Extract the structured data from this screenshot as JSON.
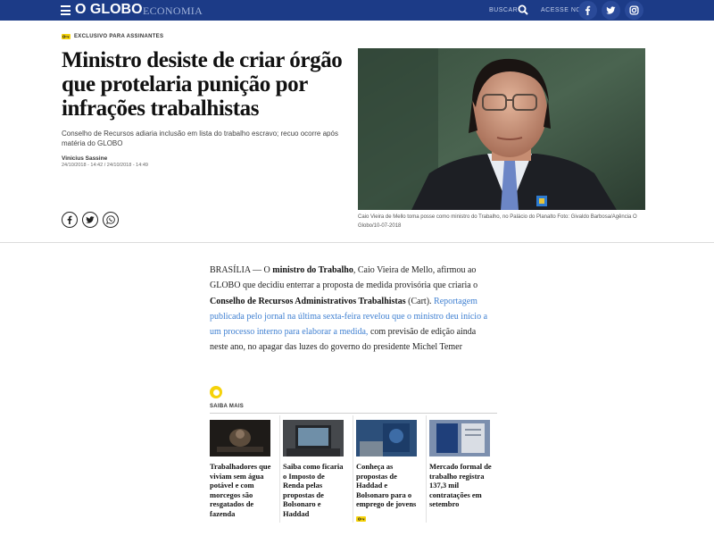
{
  "header": {
    "logo": "O GLOBO",
    "section": "ECONOMIA",
    "search_label": "BUSCAR",
    "access_label": "ACESSE NO",
    "social_icons": [
      "facebook-icon",
      "twitter-icon",
      "instagram-icon"
    ]
  },
  "article": {
    "badge": "EXCLUSIVO PARA ASSINANTES",
    "headline": "Ministro desiste de criar órgão que protelaria punição por infrações trabalhistas",
    "subhead": "Conselho de Recursos adiaria inclusão em lista do trabalho escravo; recuo ocorre após matéria do GLOBO",
    "author": "Vinicius Sassine",
    "dates": "24/10/2018 - 14:42 / 24/10/2018 - 14:49",
    "share_icons": [
      "facebook-icon",
      "twitter-icon",
      "whatsapp-icon"
    ],
    "photo_caption": "Caio Vieira de Mello toma posse como ministro do Trabalho, no Palácio do Planalto Foto: Givaldo Barbosa/Agência O Globo/10-07-2018",
    "body": {
      "p1_lead": "BRASÍLIA — O ",
      "p1_bold1": "ministro do Trabalho",
      "p1_text1": ", Caio Vieira de Mello, afirmou ao GLOBO que decidiu enterrar a proposta de medida provisória que criaria o ",
      "p1_bold2": "Conselho de Recursos Administrativos Trabalhistas",
      "p1_text2": " (Cart). ",
      "p1_link": "Reportagem publicada pelo jornal na última sexta-feira revelou que o ministro deu início a um processo interno para elaborar a medida,",
      "p1_text3": " com previsão de edição ainda neste ano, no apagar das luzes do governo do presidente Michel Temer"
    }
  },
  "saiba_mais": {
    "label": "SAIBA MAIS",
    "cards": [
      {
        "title": "Trabalhadores que viviam sem água potável e com morcegos são resgatados de fazenda"
      },
      {
        "title": "Saiba como ficaria o Imposto de Renda pelas propostas de Bolsonaro e Haddad"
      },
      {
        "title": "Conheça as propostas de Haddad e Bolsonaro para o emprego de jovens",
        "exclusive": true
      },
      {
        "title": "Mercado formal de trabalho registra 137,3 mil contratações em setembro"
      }
    ]
  },
  "colors": {
    "topbar": "#1c3b87",
    "accent_yellow": "#f5d20a",
    "link_blue": "#3e7fd1"
  }
}
